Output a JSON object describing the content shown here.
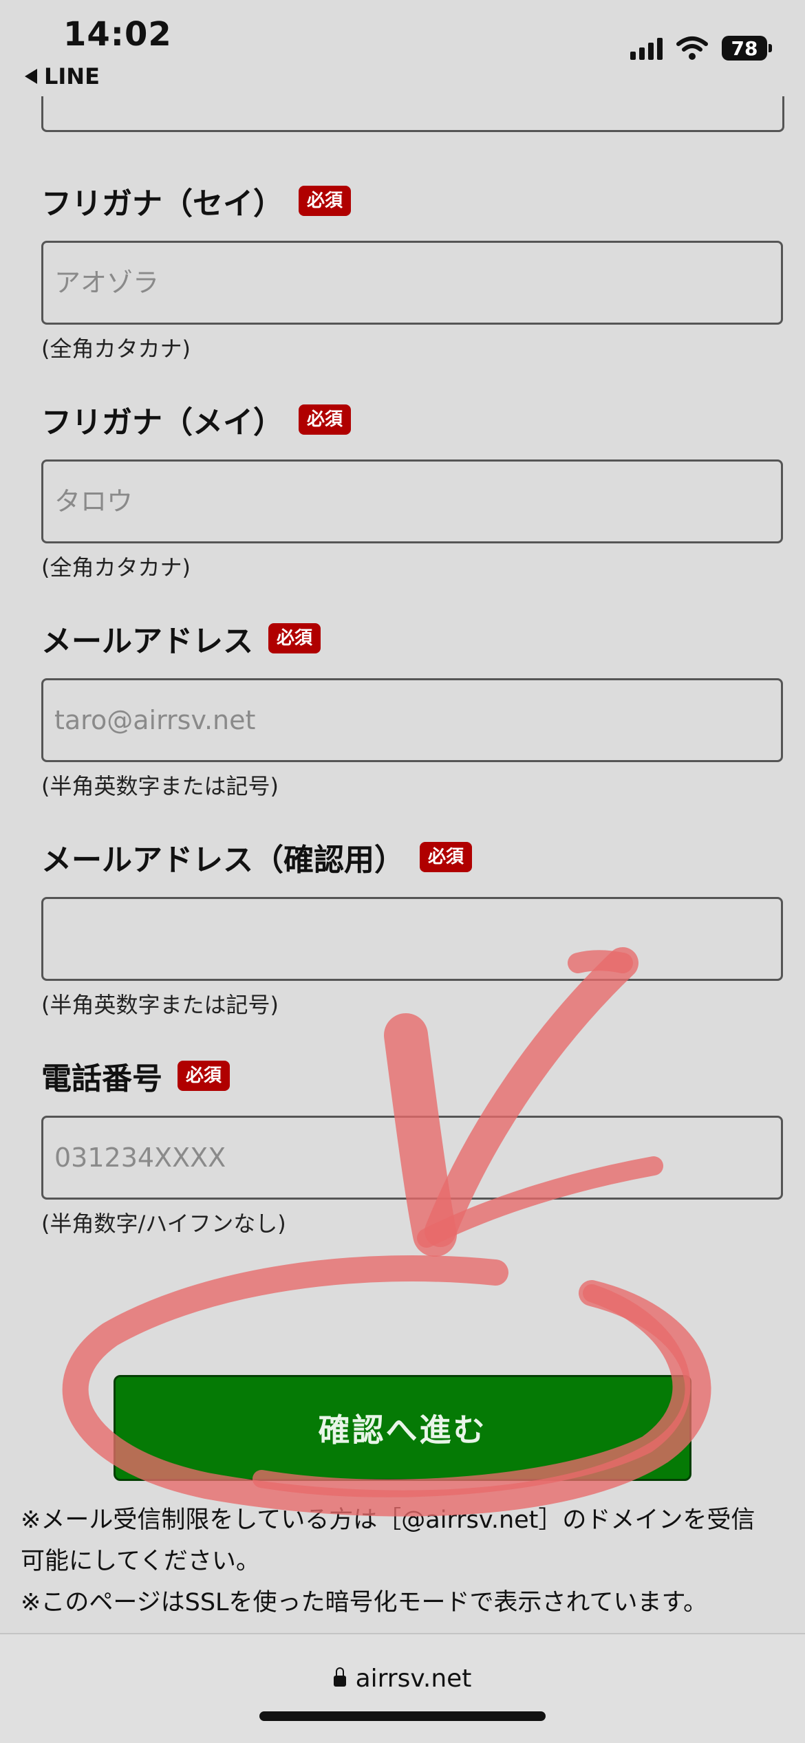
{
  "status_bar": {
    "time": "14:02",
    "back_label": "LINE",
    "battery": "78",
    "icons": [
      "cellular-signal-icon",
      "wifi-icon",
      "battery-icon"
    ]
  },
  "form": {
    "fields": [
      {
        "label": "フリガナ（セイ）",
        "required": "必須",
        "placeholder": "アオゾラ",
        "hint": "(全角カタカナ)"
      },
      {
        "label": "フリガナ（メイ）",
        "required": "必須",
        "placeholder": "タロウ",
        "hint": "(全角カタカナ)"
      },
      {
        "label": "メールアドレス",
        "required": "必須",
        "placeholder": "taro@airrsv.net",
        "hint": "(半角英数字または記号)"
      },
      {
        "label": "メールアドレス（確認用）",
        "required": "必須",
        "placeholder": "",
        "hint": "(半角英数字または記号)"
      },
      {
        "label": "電話番号",
        "required": "必須",
        "placeholder": "031234XXXX",
        "hint": "(半角数字/ハイフンなし)"
      }
    ],
    "submit_label": "確認へ進む"
  },
  "notes": {
    "line1": "※メール受信制限をしている方は［@airrsv.net］のドメインを受信",
    "line2": "可能にしてください。",
    "line3": "※このページはSSLを使った暗号化モードで表示されています。"
  },
  "browser": {
    "url": "airrsv.net"
  },
  "colors": {
    "background": "#dcdcdc",
    "required_badge": "#b00000",
    "submit_button": "#057a05",
    "annotation_stroke": "#e86a6a"
  }
}
